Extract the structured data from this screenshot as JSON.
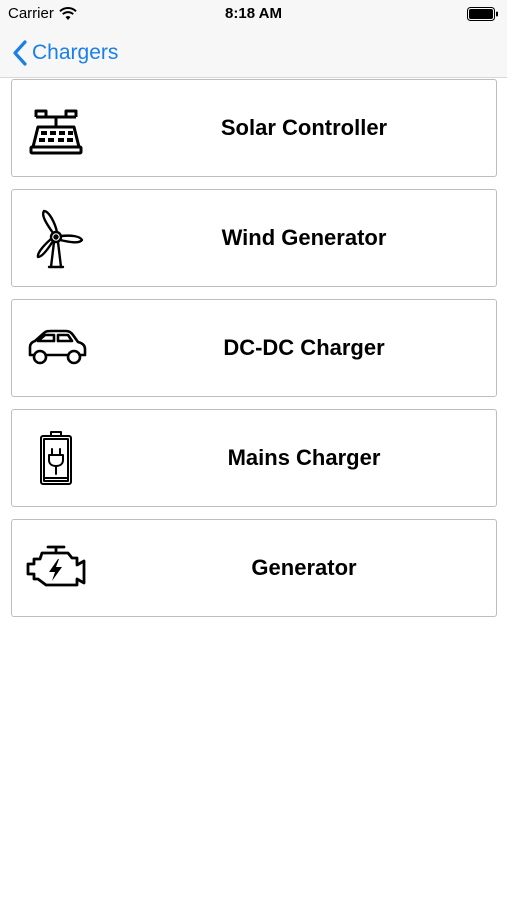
{
  "status_bar": {
    "carrier": "Carrier",
    "time": "8:18 AM"
  },
  "nav": {
    "back_label": "Chargers",
    "accent_color": "#1a7fe6"
  },
  "items": [
    {
      "label": "Solar Controller",
      "icon": "solar-controller-icon"
    },
    {
      "label": "Wind Generator",
      "icon": "wind-turbine-icon"
    },
    {
      "label": "DC-DC Charger",
      "icon": "car-icon"
    },
    {
      "label": "Mains Charger",
      "icon": "battery-plug-icon"
    },
    {
      "label": "Generator",
      "icon": "engine-icon"
    }
  ]
}
